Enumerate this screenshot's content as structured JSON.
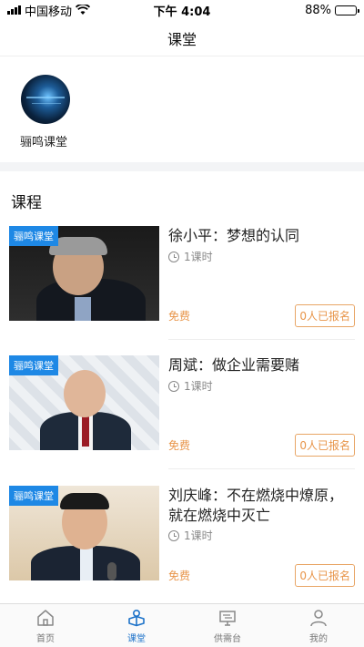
{
  "status_bar": {
    "carrier": "中国移动",
    "time": "下午 4:04",
    "battery": "88%",
    "battery_level": 0.88
  },
  "nav": {
    "title": "课堂"
  },
  "channel": {
    "name": "骊鸣课堂",
    "avatar_icon": "globe-network-avatar"
  },
  "section": {
    "title": "课程"
  },
  "courses": [
    {
      "tag": "骊鸣课堂",
      "title": "徐小平：梦想的认同",
      "hours": "1课时",
      "price": "免费",
      "signup": "0人已报名"
    },
    {
      "tag": "骊鸣课堂",
      "title": "周斌：做企业需要赌",
      "hours": "1课时",
      "price": "免费",
      "signup": "0人已报名"
    },
    {
      "tag": "骊鸣课堂",
      "title": "刘庆峰：不在燃烧中燎原，就在燃烧中灭亡",
      "hours": "1课时",
      "price": "免费",
      "signup": "0人已报名"
    }
  ],
  "tabs": [
    {
      "label": "首页",
      "icon": "home-icon",
      "active": false
    },
    {
      "label": "课堂",
      "icon": "classroom-icon",
      "active": true
    },
    {
      "label": "供需台",
      "icon": "monitor-icon",
      "active": false
    },
    {
      "label": "我的",
      "icon": "profile-icon",
      "active": false
    }
  ],
  "colors": {
    "accent": "#1e73c9",
    "tag_bg": "#1e88e5",
    "price": "#e8954a"
  }
}
